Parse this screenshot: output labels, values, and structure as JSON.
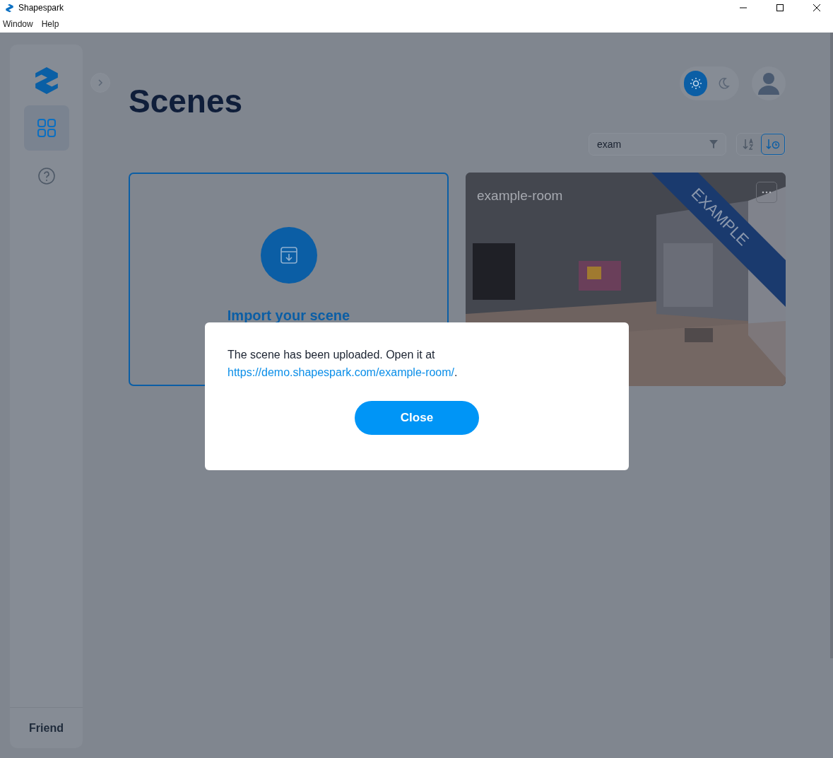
{
  "window": {
    "title": "Shapespark"
  },
  "menu": [
    "Window",
    "Help"
  ],
  "sidebar": {
    "items": [
      {
        "kind": "scenes",
        "selected": true
      },
      {
        "kind": "help",
        "selected": false
      }
    ],
    "footer": "Friend"
  },
  "theme": [
    {
      "kind": "light",
      "selected": true
    },
    {
      "kind": "dark",
      "selected": false
    }
  ],
  "page_title": "Scenes",
  "filter": {
    "value": "exam"
  },
  "sort": [
    {
      "kind": "name",
      "selected": false
    },
    {
      "kind": "date",
      "selected": true
    }
  ],
  "import_card": {
    "label": "Import your scene"
  },
  "scenes": [
    {
      "name": "example-room",
      "badge": "EXAMPLE",
      "kind": "picture"
    }
  ],
  "dialog": {
    "text": "The scene has been uploaded. Open it at",
    "link": "https://demo.shapespark.com/example-room/",
    "after_link": ".",
    "button": "Close"
  }
}
